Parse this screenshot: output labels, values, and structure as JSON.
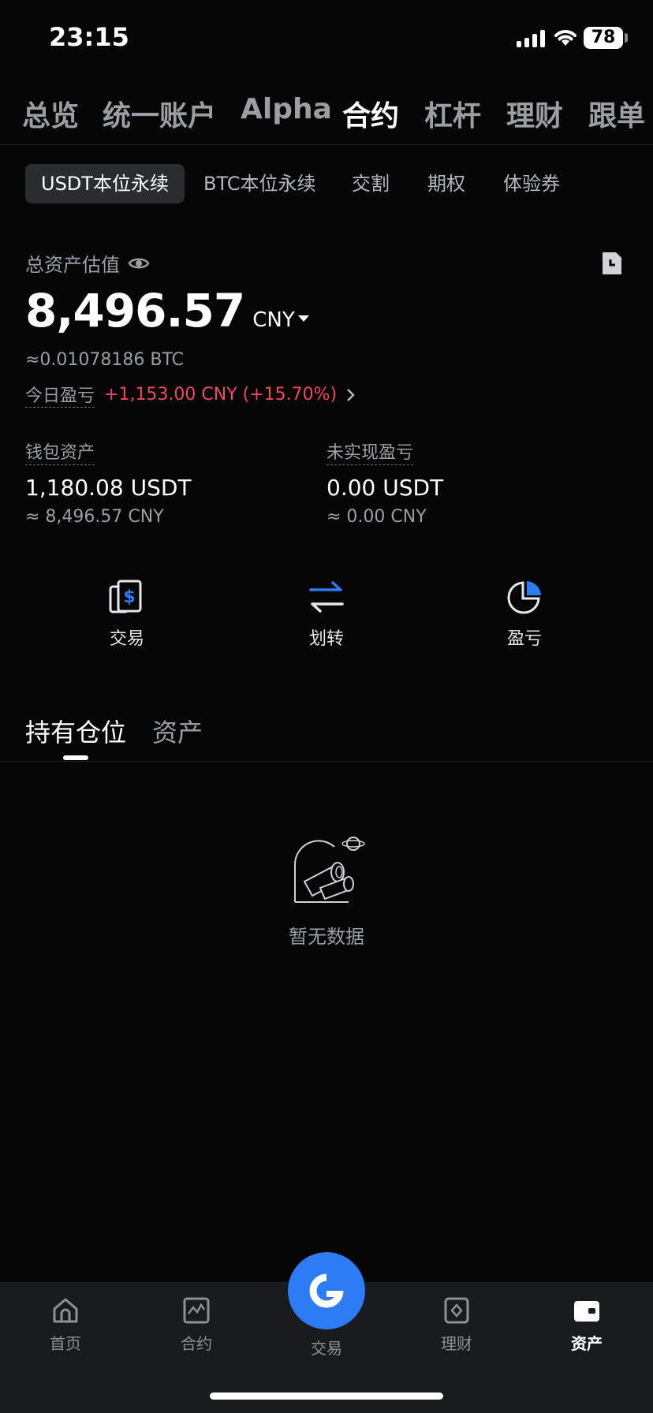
{
  "status_bar": {
    "time": "23:15",
    "battery": "78"
  },
  "top_nav": {
    "items": [
      "总览",
      "统一账户",
      "Alpha",
      "合约",
      "杠杆",
      "理财",
      "跟单"
    ],
    "active": "合约"
  },
  "sub_tabs": {
    "items": [
      "USDT本位永续",
      "BTC本位永续",
      "交割",
      "期权",
      "体验券"
    ],
    "active": "USDT本位永续"
  },
  "balance": {
    "label": "总资产估值",
    "value": "8,496.57",
    "currency": "CNY",
    "btc_approx": "≈0.01078186 BTC",
    "pnl_label": "今日盈亏",
    "pnl_value": "+1,153.00 CNY (+15.70%)"
  },
  "stats": {
    "wallet": {
      "label": "钱包资产",
      "value": "1,180.08 USDT",
      "sub": "≈ 8,496.57 CNY"
    },
    "unrealized": {
      "label": "未实现盈亏",
      "value": "0.00 USDT",
      "sub": "≈ 0.00 CNY"
    }
  },
  "actions": {
    "trade": "交易",
    "transfer": "划转",
    "pnl": "盈亏"
  },
  "main_tabs": {
    "positions": "持有仓位",
    "assets": "资产"
  },
  "empty_state": {
    "text": "暂无数据"
  },
  "bottom_nav": {
    "home": "首页",
    "futures": "合约",
    "trade": "交易",
    "earn": "理财",
    "assets": "资产"
  },
  "colors": {
    "accent": "#2d7cf5",
    "loss_red": "#f0475b",
    "background": "#060607"
  }
}
